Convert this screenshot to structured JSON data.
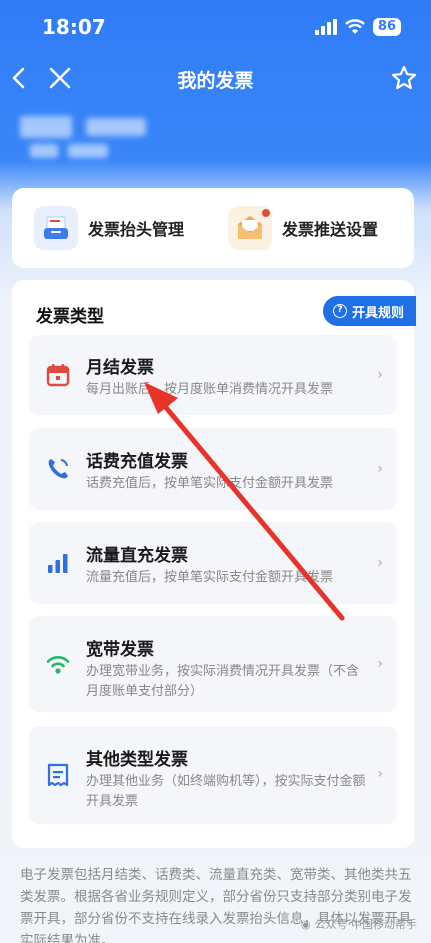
{
  "status_bar": {
    "time": "18:07",
    "battery": "86"
  },
  "nav": {
    "title": "我的发票"
  },
  "quick_actions": [
    {
      "label": "发票抬头管理",
      "icon": "invoice-tray-icon"
    },
    {
      "label": "发票推送设置",
      "icon": "mail-envelope-icon"
    }
  ],
  "section": {
    "title": "发票类型",
    "rules_label": "开具规则"
  },
  "invoice_types": [
    {
      "title": "月结发票",
      "desc": "每月出账后，按月度账单消费情况开具发票",
      "icon": "calendar-icon"
    },
    {
      "title": "话费充值发票",
      "desc": "话费充值后，按单笔实际支付金额开具发票",
      "icon": "phone-icon"
    },
    {
      "title": "流量直充发票",
      "desc": "流量充值后，按单笔实际支付金额开具发票",
      "icon": "signal-bars-icon"
    },
    {
      "title": "宽带发票",
      "desc": "办理宽带业务，按实际消费情况开具发票（不含月度账单支付部分）",
      "icon": "wifi-icon"
    },
    {
      "title": "其他类型发票",
      "desc": "办理其他业务（如终端购机等），按实际支付金额开具发票",
      "icon": "receipt-icon"
    }
  ],
  "footer": {
    "text": "电子发票包括月结类、话费类、流量直充类、宽带类、其他类共五类发票。根据各省业务规则定义，部分省份只支持部分类别电子发票开具，部分省份不支持在线录入发票抬头信息，具体以发票开具实际结果为准。"
  },
  "watermark": "公众号·中国移动帮手",
  "colors": {
    "brand_blue": "#2f7cf7",
    "accent_red": "#e04a3f",
    "rules_blue": "#1f6fe6"
  }
}
